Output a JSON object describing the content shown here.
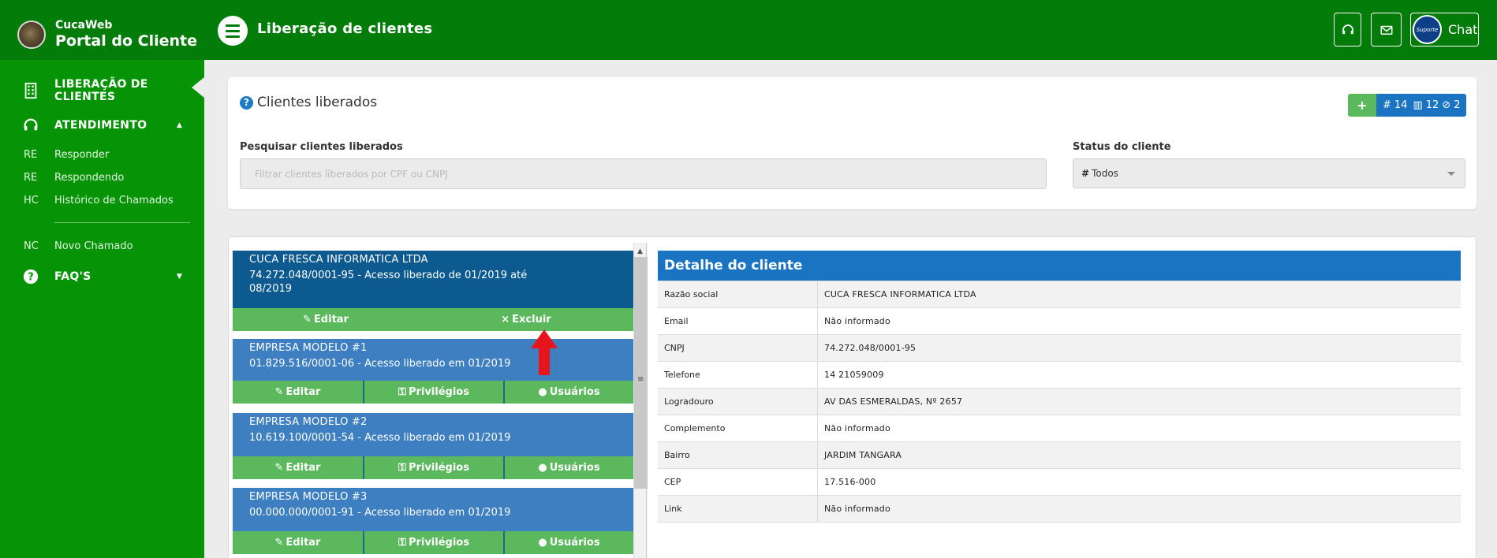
{
  "brand": {
    "subtitle": "CucaWeb",
    "title": "Portal do Cliente"
  },
  "header": {
    "page_title": "Liberação de clientes",
    "chat_label": "Chat",
    "chat_avatar_text": "Suporte"
  },
  "sidebar": {
    "main_items": [
      {
        "label": "LIBERAÇÃO DE CLIENTES",
        "icon": "building-icon"
      },
      {
        "label": "ATENDIMENTO",
        "icon": "headset-icon"
      },
      {
        "label": "FAQ'S",
        "icon": "question-icon"
      }
    ],
    "sub_items": [
      {
        "abbr": "RE",
        "label": "Responder"
      },
      {
        "abbr": "RE",
        "label": "Respondendo"
      },
      {
        "abbr": "HC",
        "label": "Histórico de Chamados"
      },
      {
        "abbr": "NC",
        "label": "Novo Chamado"
      }
    ]
  },
  "filters": {
    "title": "Clientes liberados",
    "add_label": "+",
    "stats": {
      "total": "14",
      "active": "12",
      "blocked": "2"
    },
    "search_label": "Pesquisar clientes liberados",
    "search_placeholder": "Filtrar clientes liberados por CPF ou CNPJ",
    "status_label": "Status do cliente",
    "status_value": "Todos"
  },
  "clients": [
    {
      "name": "CUCA FRESCA INFORMATICA LTDA",
      "detail": "74.272.048/0001-95 - Acesso liberado de 01/2019 até 08/2019",
      "actions": [
        "Editar",
        "Excluir"
      ]
    },
    {
      "name": "EMPRESA MODELO #1",
      "detail": "01.829.516/0001-06 - Acesso liberado em 01/2019",
      "actions": [
        "Editar",
        "Privilégios",
        "Usuários"
      ]
    },
    {
      "name": "EMPRESA MODELO #2",
      "detail": "10.619.100/0001-54 - Acesso liberado em 01/2019",
      "actions": [
        "Editar",
        "Privilégios",
        "Usuários"
      ]
    },
    {
      "name": "EMPRESA MODELO #3",
      "detail": "00.000.000/0001-91 - Acesso liberado em 01/2019",
      "actions": [
        "Editar",
        "Privilégios",
        "Usuários"
      ]
    }
  ],
  "detail": {
    "title": "Detalhe do cliente",
    "rows": [
      {
        "key": "Razão social",
        "value": "CUCA FRESCA INFORMATICA LTDA"
      },
      {
        "key": "Email",
        "value": "Não informado"
      },
      {
        "key": "CNPJ",
        "value": "74.272.048/0001-95"
      },
      {
        "key": "Telefone",
        "value": "14 21059009"
      },
      {
        "key": "Logradouro",
        "value": "AV DAS ESMERALDAS, Nº 2657"
      },
      {
        "key": "Complemento",
        "value": "Não informado"
      },
      {
        "key": "Bairro",
        "value": "JARDIM TANGARA"
      },
      {
        "key": "CEP",
        "value": "17.516-000"
      },
      {
        "key": "Link",
        "value": "Não informado"
      }
    ]
  },
  "colors": {
    "brand_green": "#047c0a",
    "sidebar_green": "#069406",
    "primary_blue": "#1b74c2",
    "selected_blue": "#0d5a90",
    "action_green": "#5cb85c",
    "annotation_red": "#e8141c"
  }
}
